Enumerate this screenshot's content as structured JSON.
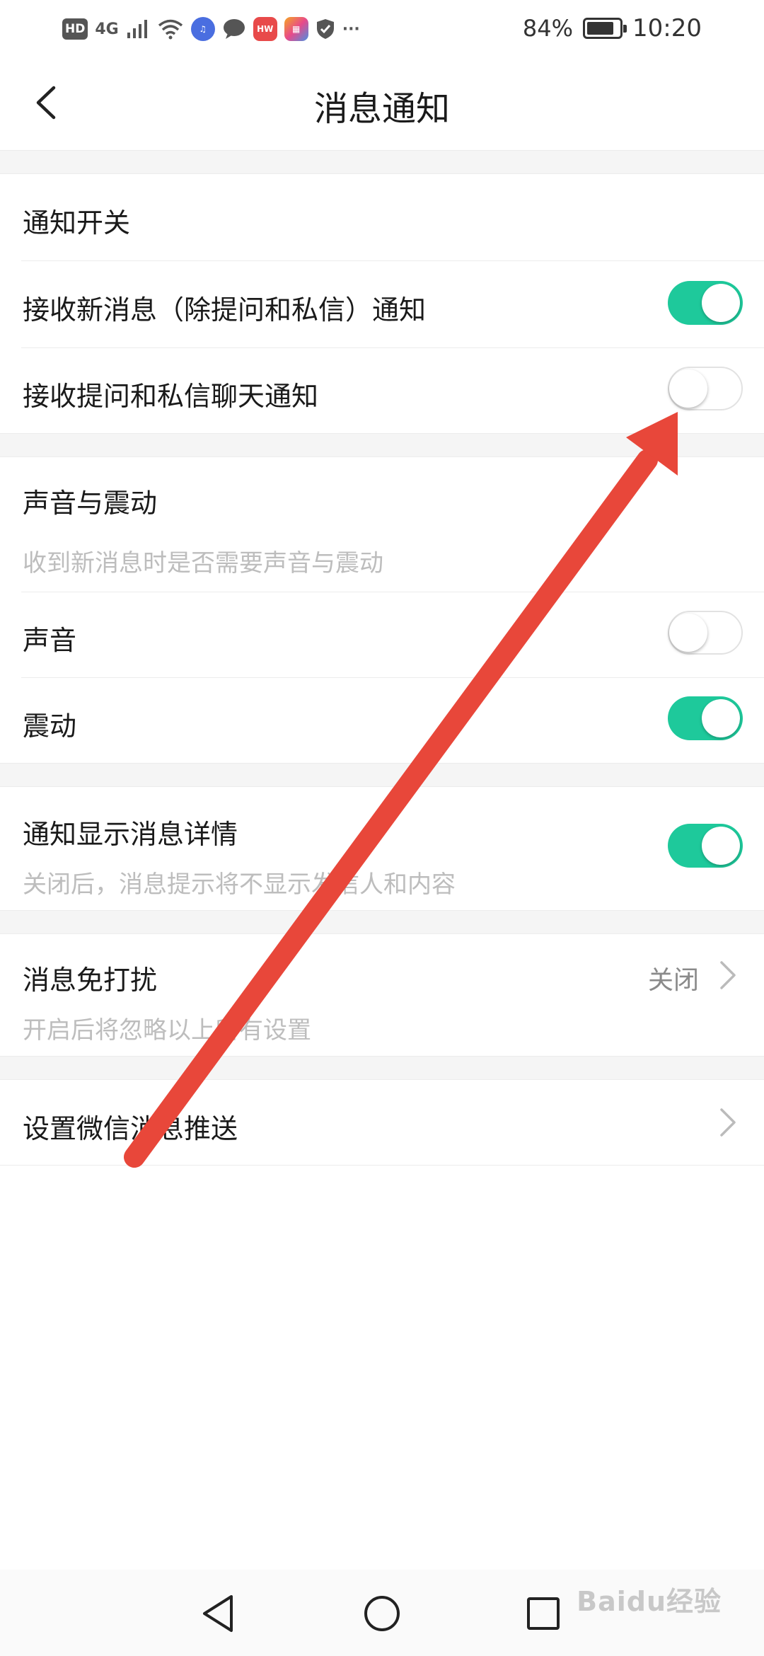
{
  "status_bar": {
    "hd_badge": "HD",
    "network": "4G",
    "more": "···",
    "battery_pct_text": "84%",
    "battery_level": 0.84,
    "time": "10:20"
  },
  "header": {
    "title": "消息通知",
    "back_icon": "chevron-left-icon"
  },
  "sections": {
    "notification_switch": {
      "title": "通知开关",
      "items": [
        {
          "label": "接收新消息（除提问和私信）通知",
          "enabled": true
        },
        {
          "label": "接收提问和私信聊天通知",
          "enabled": false
        }
      ]
    },
    "sound_vibration": {
      "title": "声音与震动",
      "subtitle": "收到新消息时是否需要声音与震动",
      "items": [
        {
          "label": "声音",
          "enabled": false
        },
        {
          "label": "震动",
          "enabled": true
        }
      ]
    },
    "detail": {
      "label": "通知显示消息详情",
      "subtitle": "关闭后，消息提示将不显示发信人和内容",
      "enabled": true
    },
    "dnd": {
      "label": "消息免打扰",
      "value": "关闭",
      "subtitle": "开启后将忽略以上所有设置"
    },
    "wechat": {
      "label": "设置微信消息推送"
    }
  },
  "watermark": "Baidu经验",
  "colors": {
    "toggle_on": "#1ec99b",
    "arrow": "#e8473a",
    "subtle_text": "#bdbdbd"
  }
}
